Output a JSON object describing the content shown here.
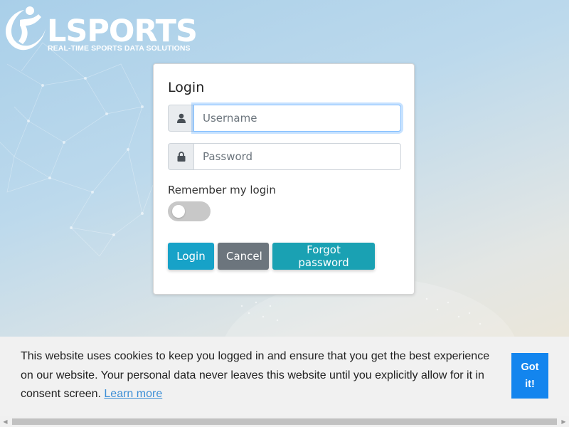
{
  "brand": {
    "name": "LSPORTS",
    "tagline": "REAL-TIME SPORTS DATA SOLUTIONS"
  },
  "login": {
    "title": "Login",
    "username_placeholder": "Username",
    "password_placeholder": "Password",
    "remember_label": "Remember my login",
    "remember_checked": false,
    "buttons": {
      "login": "Login",
      "cancel": "Cancel",
      "forgot": "Forgot password"
    }
  },
  "cookie": {
    "message": "This website uses cookies to keep you logged in and ensure that you get the best experience on our website. Your personal data never leaves this website until you explicitly allow for it in consent screen.",
    "learn_more": "Learn more",
    "accept": "Got it!"
  },
  "colors": {
    "login_button": "#17a2c8",
    "cancel_button": "#6c757d",
    "forgot_button": "#1aa1b3",
    "cookie_accept": "#1385ee",
    "link": "#3d8fd6"
  },
  "icons": {
    "username": "user-icon",
    "password": "lock-icon",
    "logo": "athlete-logo-icon"
  }
}
